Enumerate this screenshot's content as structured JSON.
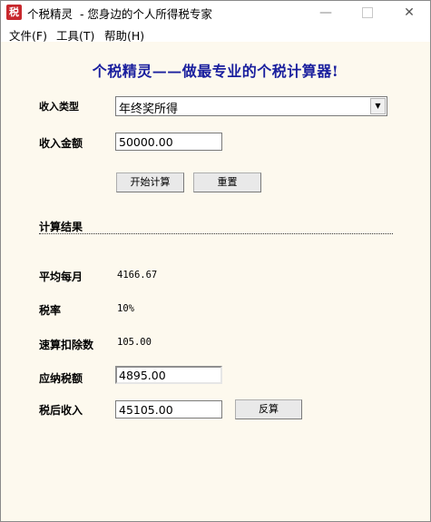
{
  "window": {
    "icon_glyph": "税",
    "title": "个税精灵  - 您身边的个人所得税专家",
    "minimize": "—",
    "close": "✕"
  },
  "menu": {
    "items": [
      "文件(F)",
      "工具(T)",
      "帮助(H)"
    ]
  },
  "form": {
    "headline": "个税精灵——做最专业的个税计算器!",
    "income_type_label": "收入类型",
    "income_type_value": "年终奖所得",
    "income_amount_label": "收入金额",
    "income_amount_value": "50000.00",
    "calculate_button": "开始计算",
    "reset_button": "重置"
  },
  "results": {
    "section_title": "计算结果",
    "monthly_avg_label": "平均每月",
    "monthly_avg_value": "4166.67",
    "tax_rate_label": "税率",
    "tax_rate_value": "10%",
    "quick_deduction_label": "速算扣除数",
    "quick_deduction_value": "105.00",
    "tax_payable_label": "应纳税额",
    "tax_payable_value": "4895.00",
    "after_tax_label": "税后收入",
    "after_tax_value": "45105.00",
    "reverse_button": "反算"
  },
  "colors": {
    "headline": "#1a1f9e",
    "background": "#fdf9ee",
    "icon_bg": "#c8282d"
  }
}
